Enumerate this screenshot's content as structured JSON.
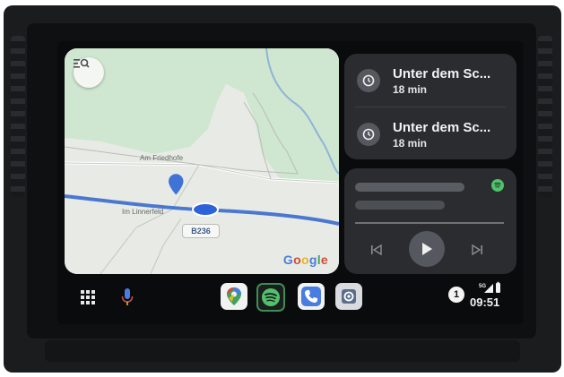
{
  "map": {
    "street_label": "Am Friedhofe",
    "street_label_2": "Im Linnerfeld",
    "road_number": "B236",
    "logo_letters": [
      "G",
      "o",
      "o",
      "g",
      "l",
      "e"
    ]
  },
  "navigation": {
    "items": [
      {
        "title": "Unter dem Sc...",
        "eta": "18 min"
      },
      {
        "title": "Unter dem Sc...",
        "eta": "18 min"
      }
    ]
  },
  "media": {
    "source_icon": "spotify-icon",
    "controls": [
      "previous-icon",
      "play-icon",
      "next-icon"
    ]
  },
  "dock": {
    "apps": [
      "google-maps-icon",
      "spotify-icon",
      "phone-icon",
      "settings-icon"
    ],
    "notification_count": "1",
    "clock": "09:51"
  },
  "colors": {
    "card_bg": "#2a2c30",
    "map_green": "#cfe6d0",
    "road_blue": "#4a78d0",
    "spotify_green": "#4fc26b"
  }
}
